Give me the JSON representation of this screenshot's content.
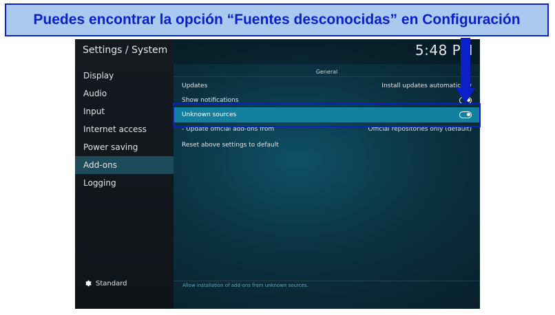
{
  "annotation": {
    "banner_text": "Puedes encontrar la opción “Fuentes desconocidas” en Configuración",
    "banner_bg": "#a9c9ef",
    "accent": "#0b20c9"
  },
  "window": {
    "title": "Settings / System",
    "clock": "5:48 PM"
  },
  "sidebar": {
    "items": [
      {
        "label": "Display"
      },
      {
        "label": "Audio"
      },
      {
        "label": "Input"
      },
      {
        "label": "Internet access"
      },
      {
        "label": "Power saving"
      },
      {
        "label": "Add-ons",
        "active": true
      },
      {
        "label": "Logging"
      }
    ],
    "level_label": "Standard",
    "level_icon": "gear-icon"
  },
  "main": {
    "group_title": "General",
    "rows": [
      {
        "label": "Updates",
        "value": "Install updates automatically"
      },
      {
        "label": "Show notifications",
        "value": "",
        "toggle": "on"
      },
      {
        "label": "Unknown sources",
        "value": "",
        "toggle": "on",
        "selected": true
      },
      {
        "label": "- Update official add-ons from",
        "value": "Official repositories only (default)"
      },
      {
        "label": "Reset above settings to default",
        "value": ""
      }
    ],
    "help_text": "Allow installation of add-ons from unknown sources."
  }
}
